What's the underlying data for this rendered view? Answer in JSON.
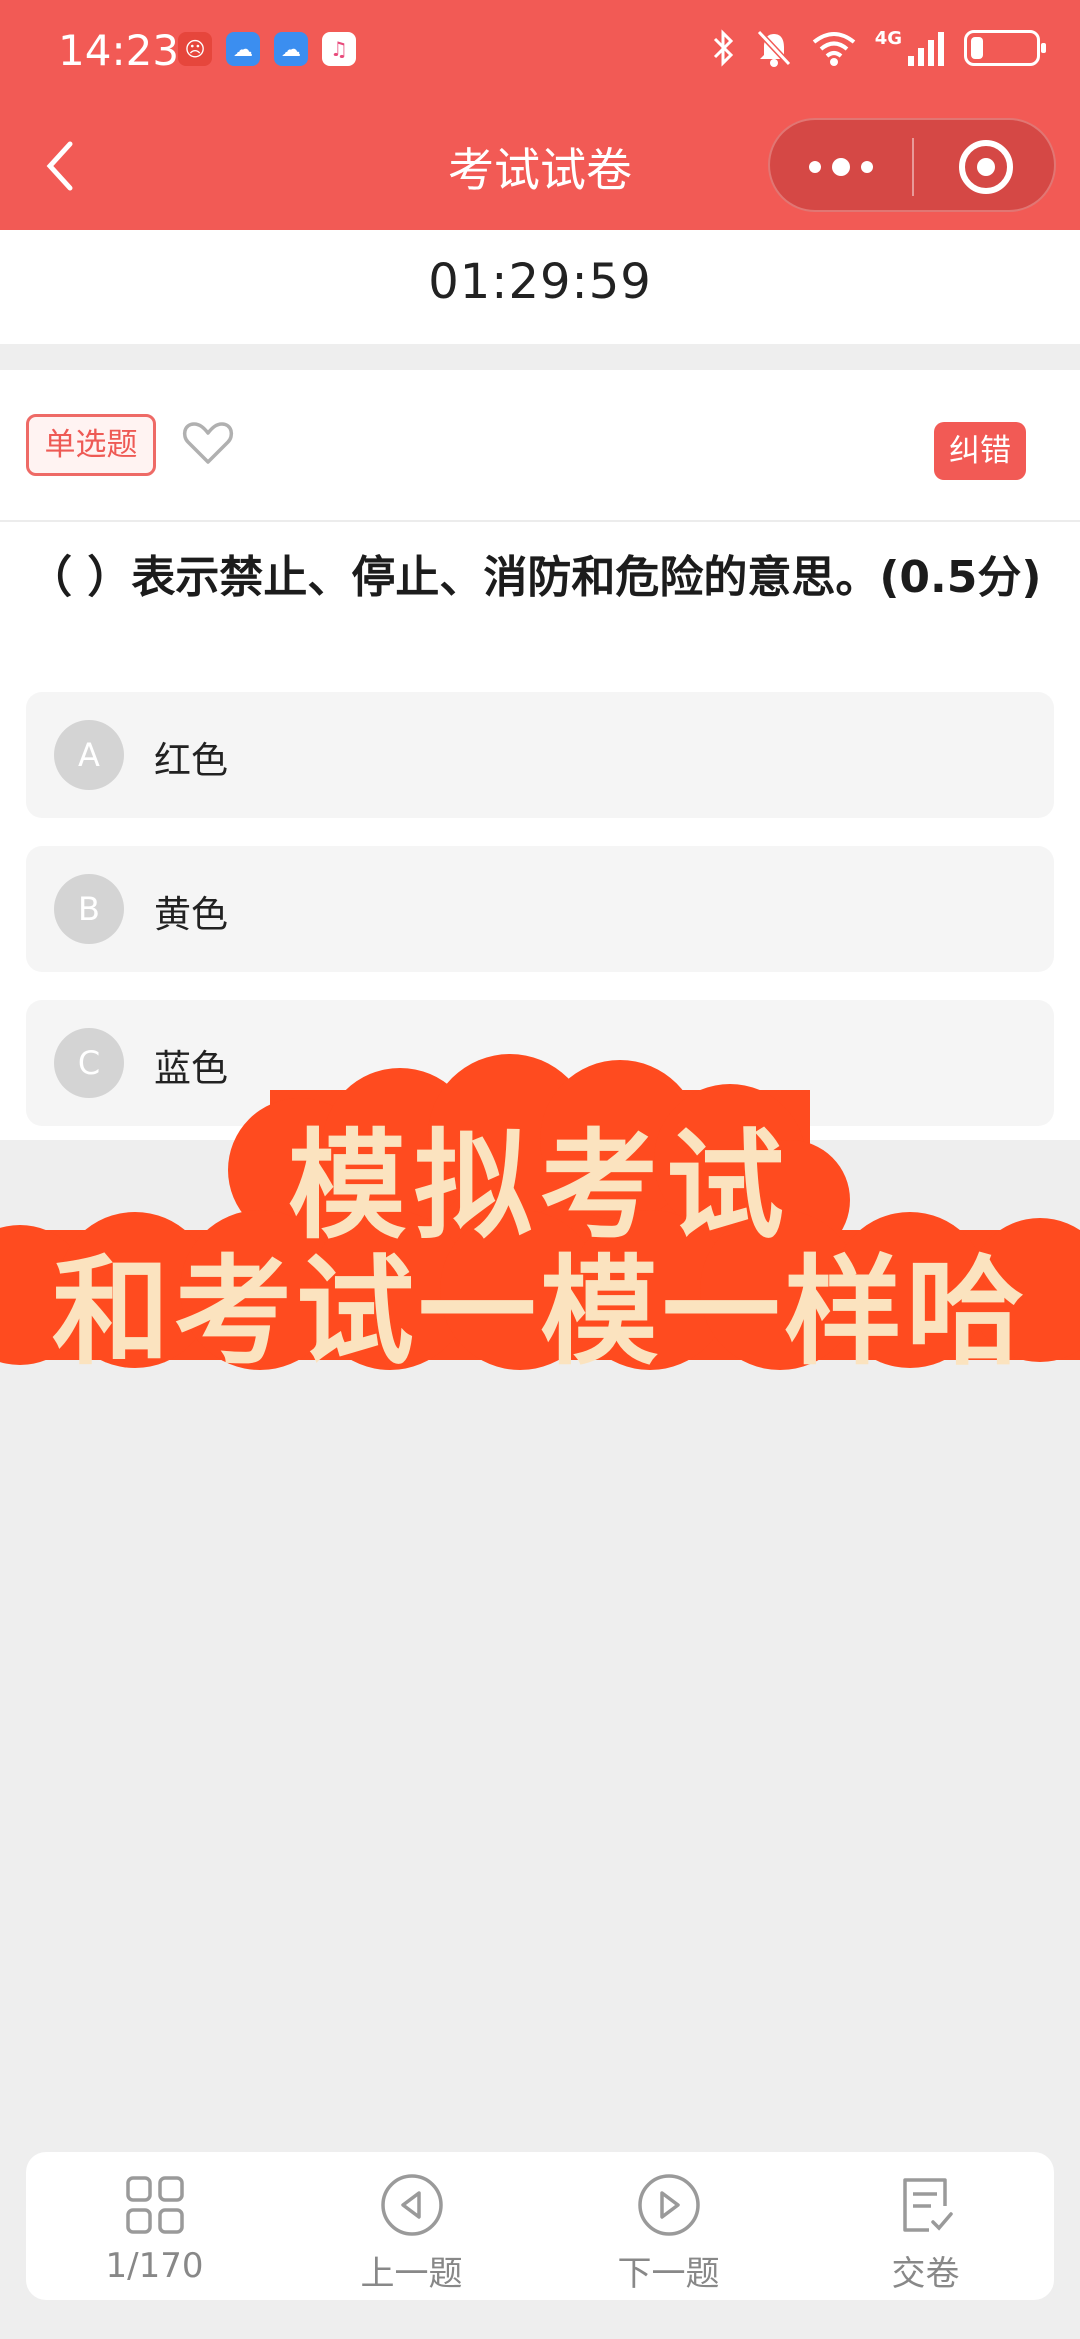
{
  "status_bar": {
    "time": "14:23",
    "network": "4G",
    "battery_level": 0.2,
    "app_icons": [
      "weibo-icon",
      "cloud-icon",
      "cloud-icon",
      "music-icon"
    ]
  },
  "header": {
    "title": "考试试卷"
  },
  "timer": "01:29:59",
  "question": {
    "type_label": "单选题",
    "report_label": "纠错",
    "text": "（ ）表示禁止、停止、消防和危险的意思。(0.5分)",
    "options": [
      {
        "letter": "A",
        "text": "红色"
      },
      {
        "letter": "B",
        "text": "黄色"
      },
      {
        "letter": "C",
        "text": "蓝色"
      }
    ]
  },
  "overlay": {
    "line1": "模拟考试",
    "line2": "和考试一模一样哈"
  },
  "bottom_nav": {
    "progress": "1/170",
    "prev_label": "上一题",
    "next_label": "下一题",
    "submit_label": "交卷"
  },
  "colors": {
    "brand": "#f25a55",
    "banner": "#ff4b1f",
    "banner_text": "#fbe3bf"
  }
}
